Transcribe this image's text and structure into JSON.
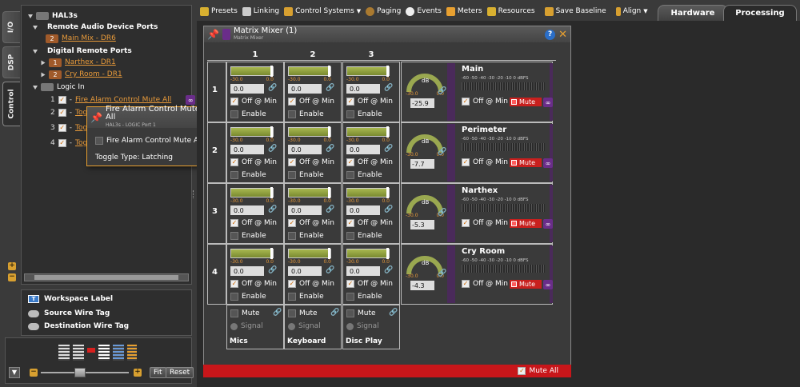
{
  "vtabs": {
    "io": "I/O",
    "dsp": "DSP",
    "control": "Control"
  },
  "tree": {
    "root": "HAL3s",
    "remote_ports": "Remote Audio Device Ports",
    "main_mix": {
      "num": "2",
      "label": "Main Mix - DR6"
    },
    "digital_ports": "Digital Remote Ports",
    "narthex": {
      "num": "1",
      "label": "Narthex - DR1"
    },
    "cry_room": {
      "num": "2",
      "label": "Cry Room - DR1"
    },
    "logic_in": "Logic In",
    "logic_items": [
      {
        "num": "1",
        "prefix": "-",
        "label": "Fire Alarm Control Mute All"
      },
      {
        "num": "2",
        "prefix": "-",
        "label": "Tog"
      },
      {
        "num": "3",
        "prefix": "-",
        "label": "Tog"
      },
      {
        "num": "4",
        "prefix": "-",
        "label": "Tog"
      }
    ]
  },
  "popup": {
    "title": "Fire Alarm Control Mute All",
    "subtitle": "HAL3s - LOGIC Port 1",
    "item_label": "Fire Alarm Control Mute All",
    "toggle_type": "Toggle Type: Latching"
  },
  "legend": {
    "workspace": "Workspace Label",
    "source": "Source Wire Tag",
    "destination": "Destination Wire Tag"
  },
  "nav": {
    "fit": "Fit",
    "reset": "Reset"
  },
  "toolbar": [
    "Presets",
    "Linking",
    "Control Systems",
    "Paging",
    "Events",
    "Meters",
    "Resources",
    "Save Baseline",
    "Align"
  ],
  "tabs": {
    "hardware": "Hardware",
    "processing": "Processing"
  },
  "mixer": {
    "title": "Matrix Mixer (1)",
    "subtitle": "Matrix Mixer",
    "columns": [
      "1",
      "2",
      "3"
    ],
    "rows": [
      "1",
      "2",
      "3",
      "4"
    ],
    "scale_min": "-30.0",
    "scale_max": "0.0",
    "cell_value": "0.0",
    "off_at_min": "Off @ Min",
    "enable": "Enable",
    "db": "dB",
    "outputs": [
      {
        "name": "Main",
        "level": "-25.9"
      },
      {
        "name": "Perimeter",
        "level": "-7.7"
      },
      {
        "name": "Narthex",
        "level": "-5.3"
      },
      {
        "name": "Cry Room",
        "level": "-4.3"
      }
    ],
    "meter_scale": "-60 -50 -40 -30 -20 -10 0 dBFS",
    "meter_scale_alt": "-60 -50 -40 -30 -20 -10 0 dBFS",
    "mute": "Mute",
    "signal": "Signal",
    "inputs": [
      "Mics",
      "Keyboard",
      "Disc Play"
    ],
    "mute_all": "Mute All"
  },
  "colors": {
    "accent": "#e8a030",
    "mute": "#c8201e",
    "fader": "#a8b850",
    "link": "#6a2d8a"
  }
}
